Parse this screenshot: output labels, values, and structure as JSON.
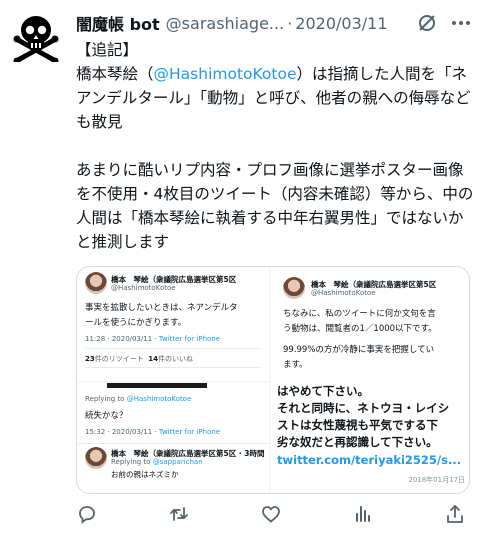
{
  "tweet": {
    "author_name": "闇魔帳 bot",
    "handle": "@sarashiage...",
    "separator": "·",
    "date": "2020/03/11",
    "text_part1": "【追記】\n橋本琴絵（",
    "mention": "@HashimotoKotoe",
    "text_part2": "）は指摘した人間を「ネアンデルタール」「動物」と呼び、他者の親への侮辱なども散見\n\nあまりに酷いリプ内容・プロフ画像に選挙ポスター画像を不使用・4枚目のツイート（内容未確認）等から、中の人間は「橋本琴絵に執着する中年右翼男性」ではないかと推測します"
  },
  "media": {
    "pane1": {
      "name": "橋本　琴絵（衆議院広島選挙区第5区",
      "handle": "@HashimotoKotoe",
      "text": "事実を拡散したいときは、ネアンデルタ\nールを使うにかぎります。",
      "time": "11:28 · 2020/03/11 · ",
      "client": "Twitter for iPhone",
      "retweets": "23",
      "retweets_label": "件のリツイート",
      "likes": "14",
      "likes_label": "件のいいね"
    },
    "pane2": {
      "replying_label": "Replying to ",
      "replying_to": "@HashimotoKotoe",
      "text": "続失かな？",
      "time": "15:32 · 2020/03/11 · ",
      "client": "Twitter for iPhone",
      "reply_name": "橋本　琴絵（衆議院広島選挙区第5区 · 3時間",
      "reply_replying_label": "Replying to ",
      "reply_replying_to": "@sapparichan",
      "reply_text": "お前の親はネズミか"
    },
    "pane3": {
      "name": "橋本　琴絵（衆議院広島選挙区第5区",
      "handle": "@HashimotoKotoe",
      "text": "ちなみに、私のツイートに何か文句を言\nう動物は、閲覧者の1／1000以下です。",
      "text2": "99.99%の方が冷静に事実を把握してい\nます。",
      "big_text": "はやめて下さい。\nそれと同時に、ネトウヨ・レイシ\nストは女性蔑視も平気でする下\n劣な奴だと再認識して下さい。",
      "link": "twitter.com/teriyaki2525/s...",
      "date": "2018年01月17日"
    }
  },
  "icons": {
    "avatar": "skull-crossbones-icon",
    "header_action": "slashed-circle-icon",
    "more": "more-dots-icon",
    "reply": "reply-icon",
    "retweet": "retweet-icon",
    "like": "like-icon",
    "analytics": "analytics-icon",
    "share": "share-icon"
  },
  "colors": {
    "link": "#1d9bf0",
    "secondary": "#536471",
    "text": "#0f1419"
  }
}
